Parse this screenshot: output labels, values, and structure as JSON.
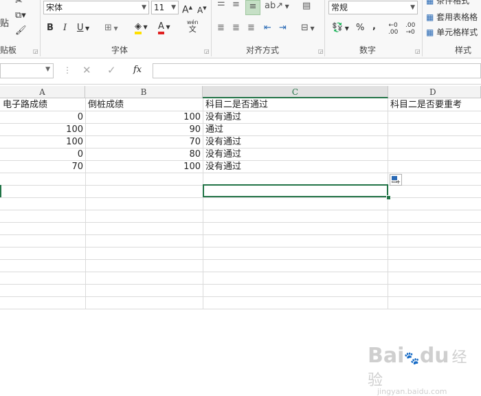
{
  "ribbon": {
    "clipboard": {
      "paste_label": "贴",
      "group_label": "贴板"
    },
    "font": {
      "font_name": "宋体",
      "font_size": "11",
      "bold": "B",
      "italic": "I",
      "underline": "U",
      "grow": "A",
      "shrink": "A",
      "phonetic_top": "wén",
      "phonetic_bottom": "文",
      "group_label": "字体"
    },
    "alignment": {
      "group_label": "对齐方式"
    },
    "number": {
      "format": "常规",
      "percent": "%",
      "comma": ",",
      "group_label": "数字"
    },
    "styles": {
      "conditional": "条件格式",
      "table_format": "套用表格格",
      "cell_styles": "单元格样式",
      "group_label": "样式"
    }
  },
  "formula_bar": {
    "name_box": "",
    "fx": "fx",
    "formula": ""
  },
  "columns": [
    "A",
    "B",
    "C",
    "D"
  ],
  "rows": [
    [
      "电子路成绩",
      "倒桩成绩",
      "科目二是否通过",
      "科目二是否要重考"
    ],
    [
      "0",
      "100",
      "没有通过",
      ""
    ],
    [
      "100",
      "90",
      "通过",
      ""
    ],
    [
      "100",
      "70",
      "没有通过",
      ""
    ],
    [
      "0",
      "80",
      "没有通过",
      ""
    ],
    [
      "70",
      "100",
      "没有通过",
      ""
    ]
  ],
  "watermark": {
    "brand": "Bai",
    "brand2": "du",
    "suffix": "经验",
    "url": "jingyan.baidu.com"
  },
  "colors": {
    "accent": "#217346",
    "font_color": "#e02020",
    "highlight": "#ffe000"
  }
}
